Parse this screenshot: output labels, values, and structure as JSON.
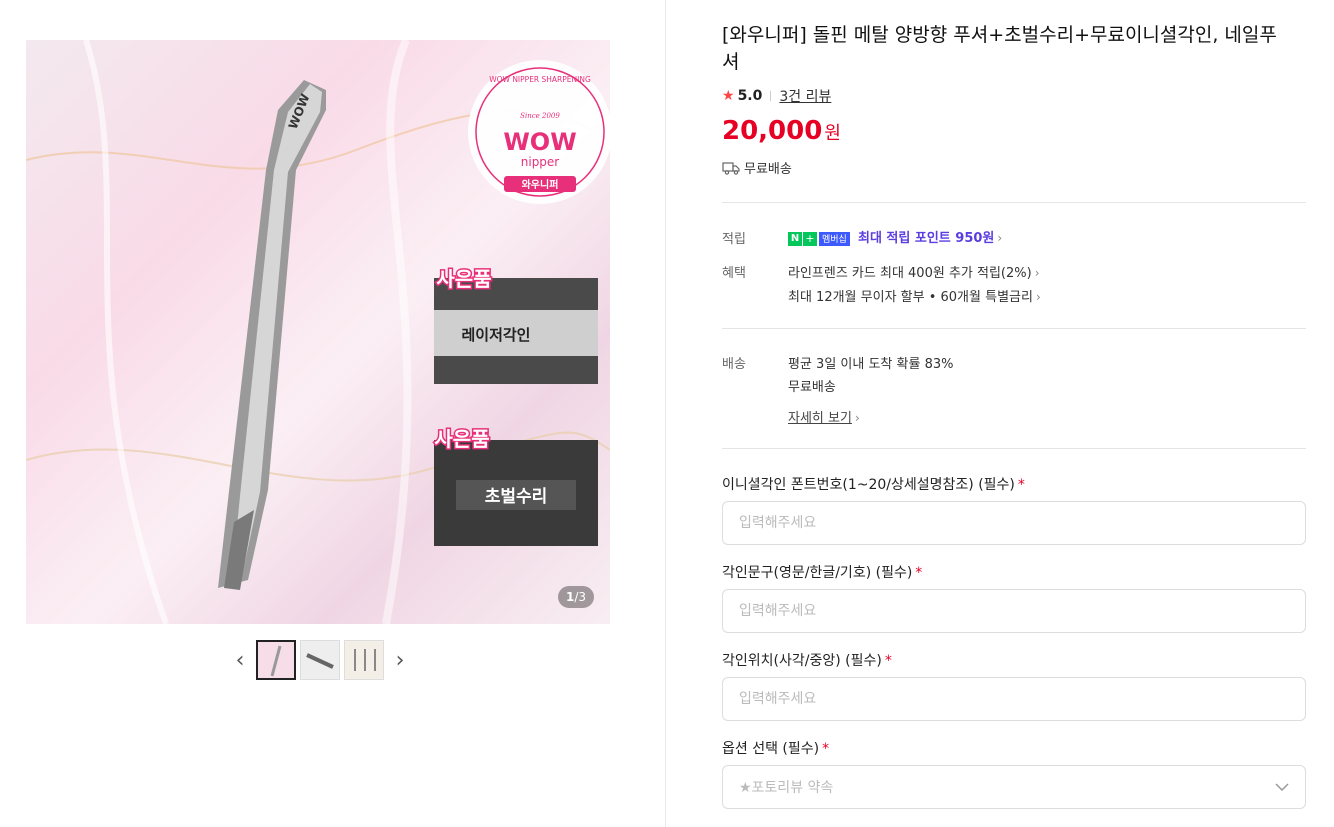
{
  "gallery": {
    "counter_current": "1",
    "counter_total": "/3",
    "badge_arc": "WOW NIPPER SHARPENING",
    "badge_since": "Since 2009",
    "badge_wow": "WOW",
    "badge_nipper": "nipper",
    "badge_kr": "와우니퍼",
    "gift1_label": "사은품",
    "gift1_text": "레이저각인",
    "gift2_label": "사은품",
    "gift2_text": "초벌수리",
    "tool_engrave": "WOW"
  },
  "product": {
    "title": "[와우니퍼] 돌핀 메탈 양방향 푸셔+초벌수리+무료이니셜각인, 네일푸셔",
    "rating": "5.0",
    "reviews": "3건 리뷰",
    "price": "20,000",
    "price_unit": "원",
    "shipping": "무료배송"
  },
  "benefits": {
    "points_label": "적립",
    "npay_n": "N",
    "npay_plus": "+",
    "npay_member": "멤버십",
    "points_text": "최대 적립 포인트 950원",
    "benefit_label": "혜택",
    "benefit_1": "라인프렌즈 카드 최대 400원 추가 적립(2%)",
    "benefit_2": "최대 12개월 무이자 할부 • 60개월 특별금리"
  },
  "delivery": {
    "label": "배송",
    "line1": "평균 3일 이내 도착 확률 83%",
    "line2": "무료배송",
    "more": "자세히 보기"
  },
  "options": {
    "field1_label": "이니셜각인 폰트번호(1~20/상세설명참조) (필수)",
    "field2_label": "각인문구(영문/한글/기호) (필수)",
    "field3_label": "각인위치(사각/중앙) (필수)",
    "field4_label": "옵션 선택 (필수)",
    "required_mark": "*",
    "placeholder": "입력해주세요",
    "select_placeholder": "★포토리뷰 약속"
  }
}
